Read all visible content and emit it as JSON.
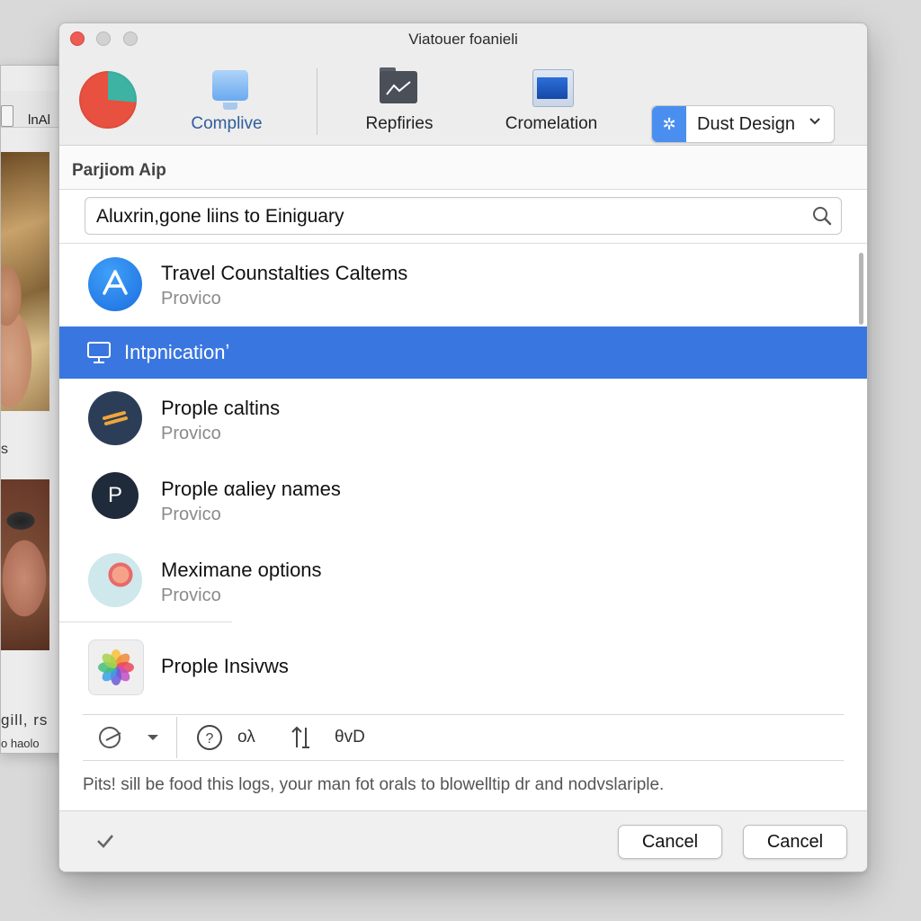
{
  "background_window": {
    "toolbar_label": "lnAl",
    "side_letter": "s",
    "footer_text_1": "gill, rs",
    "footer_text_2": "o haolo"
  },
  "window": {
    "title": "Viatouer foanieli"
  },
  "toolbar": {
    "items": [
      {
        "label": "Complive",
        "icon": "pie-chart-icon",
        "active": true
      },
      {
        "label": "Repfiries",
        "icon": "folder-icon"
      },
      {
        "label": "Cromelation",
        "icon": "display-icon"
      }
    ],
    "profile": {
      "badge_icon": "gear-icon",
      "label": "Dust Design",
      "chevron": "chevron-down-icon"
    }
  },
  "section": {
    "title": "Parjiom Aip"
  },
  "search": {
    "value": "Aluxrin,gone liins to Einiguary",
    "icon": "search-icon"
  },
  "list": {
    "items": [
      {
        "title": "Travel Counstalties Caltems",
        "subtitle": "Provico",
        "avatar": "app-store-icon"
      },
      {
        "title": "Intpnicationʼ",
        "selected": true,
        "icon": "display-icon"
      },
      {
        "title": "Prople caltins",
        "subtitle": "Provico",
        "avatar": "arrows-icon"
      },
      {
        "title": "Prople αaliey names",
        "subtitle": "Provico",
        "avatar": "p-letter-icon"
      },
      {
        "title": "Meximane options",
        "subtitle": "Provico",
        "avatar": "flower-photo-icon"
      },
      {
        "title": "Prople Insivws",
        "avatar": "photos-icon"
      }
    ]
  },
  "bottom_toolbar": {
    "items": [
      {
        "icon": "share-icon"
      },
      {
        "icon": "chevron-down-icon"
      },
      {
        "icon": "help-icon",
        "text": "ολ"
      },
      {
        "icon": "sort-icon"
      },
      {
        "text": "θvD"
      }
    ]
  },
  "hint_text": "Pits! sill be food this logs, your man fot orals to blowelltip dr and nodvslariple.",
  "footer": {
    "check_icon": "checkmark-icon",
    "buttons": [
      {
        "label": "Cancel"
      },
      {
        "label": "Cancel"
      }
    ]
  },
  "colors": {
    "accent": "#3a76e0",
    "close": "#ee5d55",
    "active_tab": "#2f5d9c"
  }
}
